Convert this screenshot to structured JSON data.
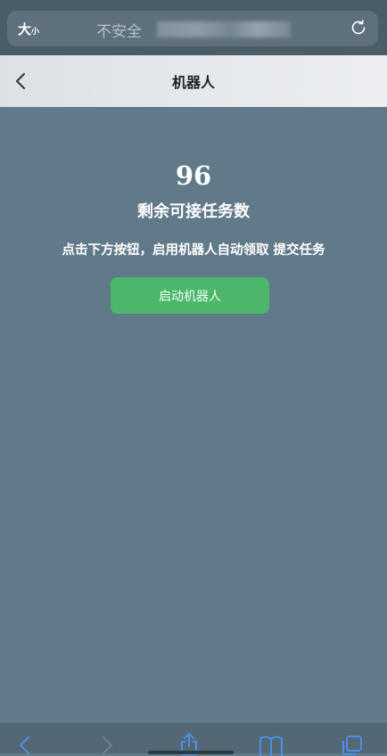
{
  "browser": {
    "text_size_label": "大",
    "text_size_small": "小",
    "security_label": "不安全",
    "icons": {
      "reload": "reload-icon"
    }
  },
  "header": {
    "title": "机器人",
    "icons": {
      "back": "chevron-left-icon"
    }
  },
  "main": {
    "task_count": "96",
    "task_count_label": "剩余可接任务数",
    "instruction": "点击下方按钮，启用机器人自动领取 提交任务",
    "start_button_label": "启动机器人"
  },
  "toolbar": {
    "icons": [
      "back-icon",
      "forward-icon",
      "share-icon",
      "bookmarks-icon",
      "tabs-icon"
    ]
  },
  "colors": {
    "page_background": "#617a89",
    "header_background": "#e6e9ec",
    "button": "#4cb76b",
    "text": "#ffffff"
  }
}
